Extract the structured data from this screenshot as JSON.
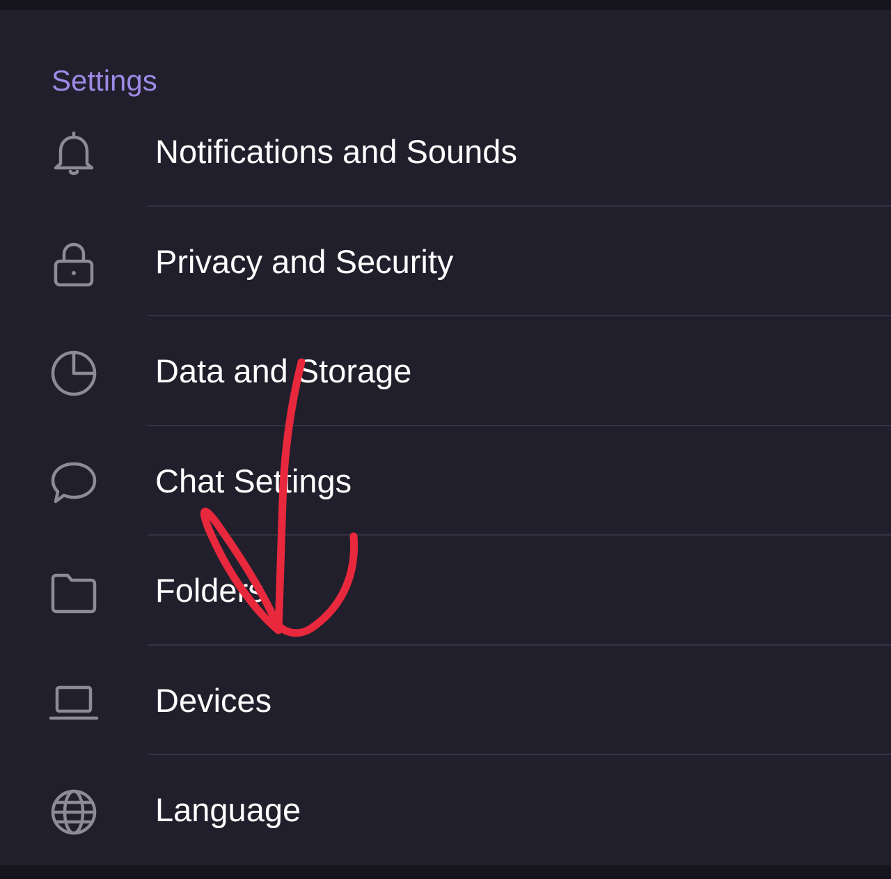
{
  "settings": {
    "title": "Settings",
    "items": [
      {
        "label": "Notifications and Sounds",
        "icon": "bell-icon"
      },
      {
        "label": "Privacy and Security",
        "icon": "lock-icon"
      },
      {
        "label": "Data and Storage",
        "icon": "pie-chart-icon"
      },
      {
        "label": "Chat Settings",
        "icon": "chat-bubble-icon"
      },
      {
        "label": "Folders",
        "icon": "folder-icon"
      },
      {
        "label": "Devices",
        "icon": "laptop-icon"
      },
      {
        "label": "Language",
        "icon": "globe-icon"
      }
    ]
  },
  "colors": {
    "background": "#221f2c",
    "accent": "#9d8ae6",
    "text": "#ffffff",
    "icon": "#8e8a98",
    "divider": "#353243",
    "annotation": "#e8283c"
  }
}
